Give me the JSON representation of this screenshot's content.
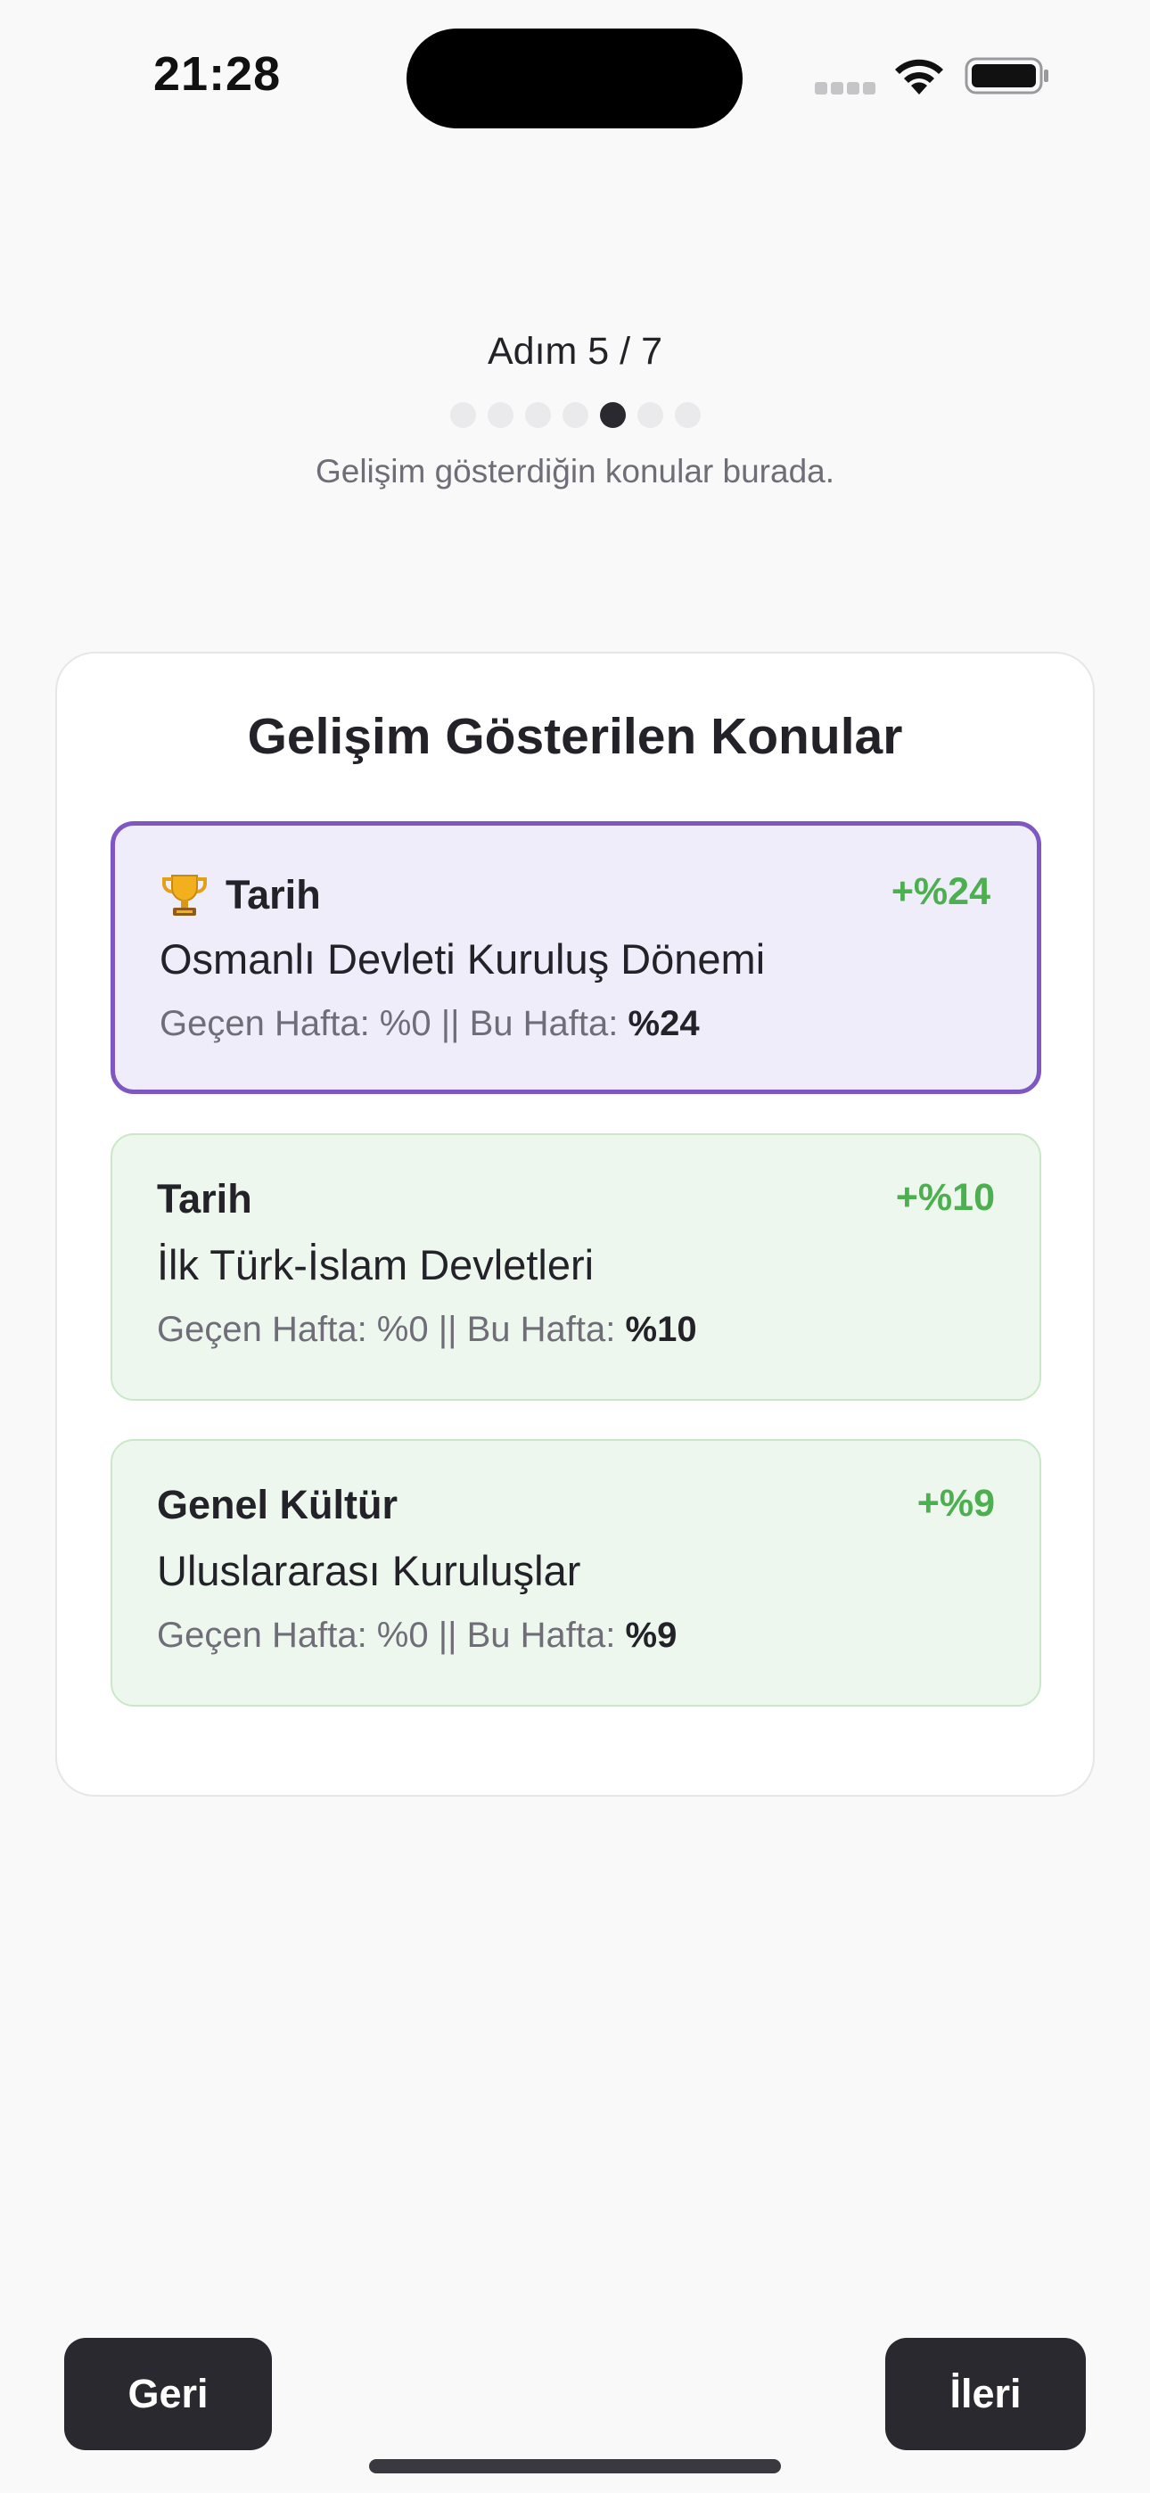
{
  "status_bar": {
    "time": "21:28"
  },
  "step": {
    "title": "Adım 5 / 7",
    "total": 7,
    "current": 5,
    "subtitle": "Gelişim gösterdiğin konular burada."
  },
  "card": {
    "title": "Gelişim Gösterilen Konular",
    "topics": [
      {
        "category": "Tarih",
        "icon": "trophy-icon",
        "delta": "+%24",
        "name": "Osmanlı Devleti Kuruluş Dönemi",
        "stats_prefix": "Geçen Hafta: %0 || Bu Hafta:",
        "current": "%24"
      },
      {
        "category": "Tarih",
        "delta": "+%10",
        "name": "İlk Türk-İslam Devletleri",
        "stats_prefix": "Geçen Hafta: %0 || Bu Hafta:",
        "current": "%10"
      },
      {
        "category": "Genel Kültür",
        "delta": "+%9",
        "name": "Uluslararası Kuruluşlar",
        "stats_prefix": "Geçen Hafta: %0 || Bu Hafta:",
        "current": "%9"
      }
    ]
  },
  "buttons": {
    "back": "Geri",
    "next": "İleri"
  },
  "colors": {
    "accent_purple": "#7e57c2",
    "positive_green": "#4caf50",
    "dark_button": "#2a292f"
  }
}
